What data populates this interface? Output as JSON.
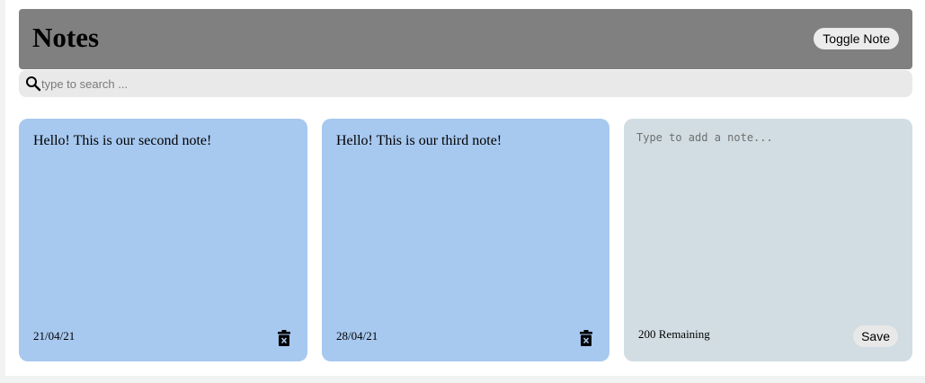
{
  "header": {
    "title": "Notes",
    "toggle_label": "Toggle Note"
  },
  "search": {
    "placeholder": "type to search ...",
    "value": ""
  },
  "notes": [
    {
      "text": "Hello! This is our second note!",
      "date": "21/04/21",
      "delete_icon": "trash-icon"
    },
    {
      "text": "Hello! This is our third note!",
      "date": "28/04/21",
      "delete_icon": "trash-icon"
    }
  ],
  "new_note": {
    "placeholder": "Type to add a note...",
    "value": "",
    "remaining": "200 Remaining",
    "save_label": "Save"
  },
  "colors": {
    "header_bg": "#808080",
    "note_bg": "#a7c8ef",
    "new_note_bg": "#d1dde3",
    "search_bg": "#e9e9e9"
  }
}
